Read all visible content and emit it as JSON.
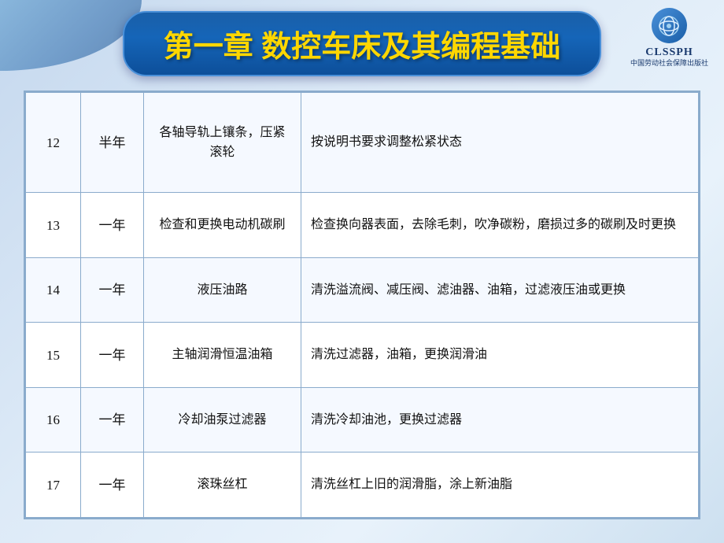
{
  "header": {
    "title": "第一章 数控车床及其编程基础",
    "logo_text": "CLSSPH",
    "logo_subtitle": "中国劳动社会保障出版社"
  },
  "table": {
    "rows": [
      {
        "num": "12",
        "period": "半年",
        "item": "各轴导轨上镶条，压紧滚轮",
        "content": "按说明书要求调整松紧状态"
      },
      {
        "num": "13",
        "period": "一年",
        "item": "检查和更换电动机碳刷",
        "content": "检查换向器表面，去除毛刺，吹净碳粉，磨损过多的碳刷及时更换"
      },
      {
        "num": "14",
        "period": "一年",
        "item": "液压油路",
        "content": "清洗溢流阀、减压阀、滤油器、油箱，过滤液压油或更换"
      },
      {
        "num": "15",
        "period": "一年",
        "item": "主轴润滑恒温油箱",
        "content": "清洗过滤器，油箱，更换润滑油"
      },
      {
        "num": "16",
        "period": "一年",
        "item": "冷却油泵过滤器",
        "content": "清洗冷却油池，更换过滤器"
      },
      {
        "num": "17",
        "period": "一年",
        "item": "滚珠丝杠",
        "content": "清洗丝杠上旧的润滑脂，涂上新油脂"
      }
    ]
  }
}
